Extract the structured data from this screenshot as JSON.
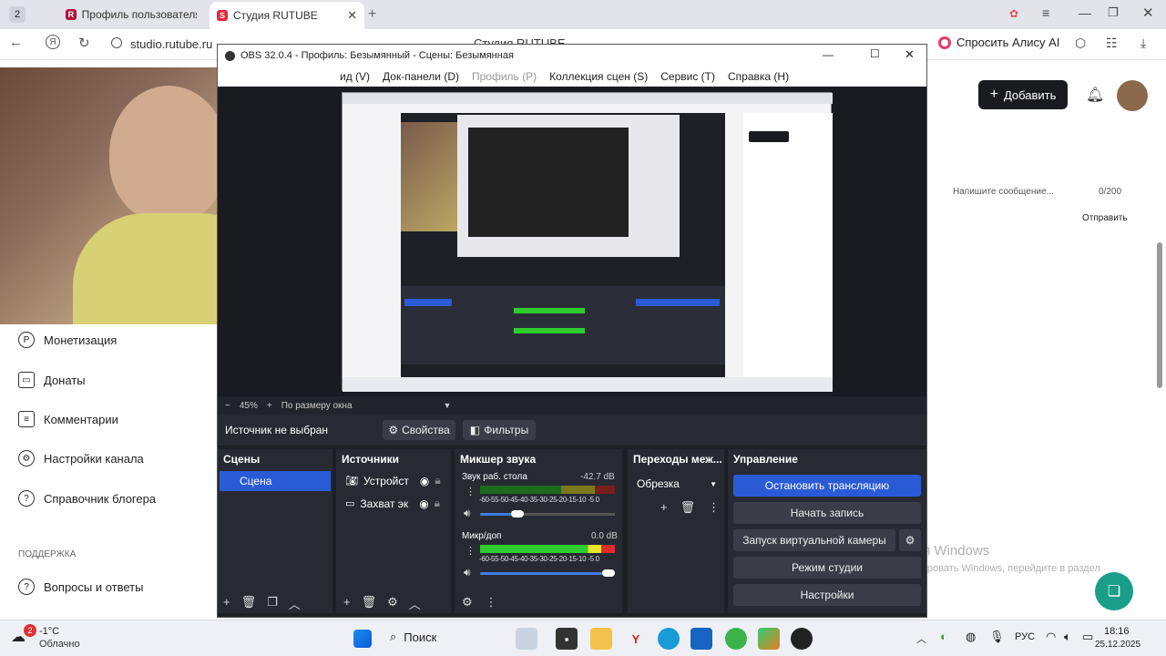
{
  "browser": {
    "tab_count": "2",
    "tabs": [
      {
        "label": "Профиль пользователя S"
      },
      {
        "label": "Студия RUTUBE"
      }
    ],
    "url": "studio.rutube.ru",
    "page_title": "Студия RUTUBE",
    "alice": "Спросить Алису AI"
  },
  "page": {
    "add_button": "Добавить",
    "message_placeholder": "Напишите сообщение...",
    "char_count": "0/200",
    "send": "Отправить",
    "sidebar": [
      {
        "label": "Монетизация"
      },
      {
        "label": "Донаты"
      },
      {
        "label": "Комментарии"
      },
      {
        "label": "Настройки канала"
      },
      {
        "label": "Справочник блогера"
      }
    ],
    "support_heading": "ПОДДЕРЖКА",
    "faq": "Вопросы и ответы",
    "watermark_title": "Активация Windows",
    "watermark_sub": "Чтобы активировать Windows, перейдите в раздел \"Параметры\"."
  },
  "obs": {
    "title": "OBS 32.0.4 - Профиль: Безымянный - Сцены: Безымянная",
    "menu": [
      "ид (V)",
      "Док-панели (D)",
      "Профиль (P)",
      "Коллекция сцен (S)",
      "Сервис (T)",
      "Справка (H)"
    ],
    "zoom": "45%",
    "fit": "По размеру окна",
    "no_source": "Источник не выбран",
    "properties": "Свойства",
    "filters": "Фильтры",
    "scenes_header": "Сцены",
    "scene_item": "Сцена",
    "sources_header": "Источники",
    "sources": [
      {
        "label": "Устройст"
      },
      {
        "label": "Захват эк"
      }
    ],
    "mixer_header": "Микшер звука",
    "mixer": [
      {
        "name": "Звук раб. стола",
        "db": "-42.7 dB"
      },
      {
        "name": "Микр/доп",
        "db": "0.0 dB"
      }
    ],
    "ticks": "-60-55-50-45-40-35-30-25-20-15-10 -5  0",
    "transitions_header": "Переходы меж...",
    "transition": "Обрезка",
    "controls_header": "Управление",
    "stop_stream": "Остановить трансляцию",
    "start_record": "Начать запись",
    "virtual_cam": "Запуск виртуальной камеры",
    "studio_mode": "Режим студии",
    "settings": "Настройки"
  },
  "taskbar": {
    "weather_temp": "-1°C",
    "weather_desc": "Облачно",
    "weather_badge": "2",
    "search": "Поиск",
    "lang": "РУС",
    "time": "18:16",
    "date": "25.12.2025"
  },
  "colors": {
    "obs_blue": "#2a5bd7",
    "rutube_red": "#e8243c"
  }
}
